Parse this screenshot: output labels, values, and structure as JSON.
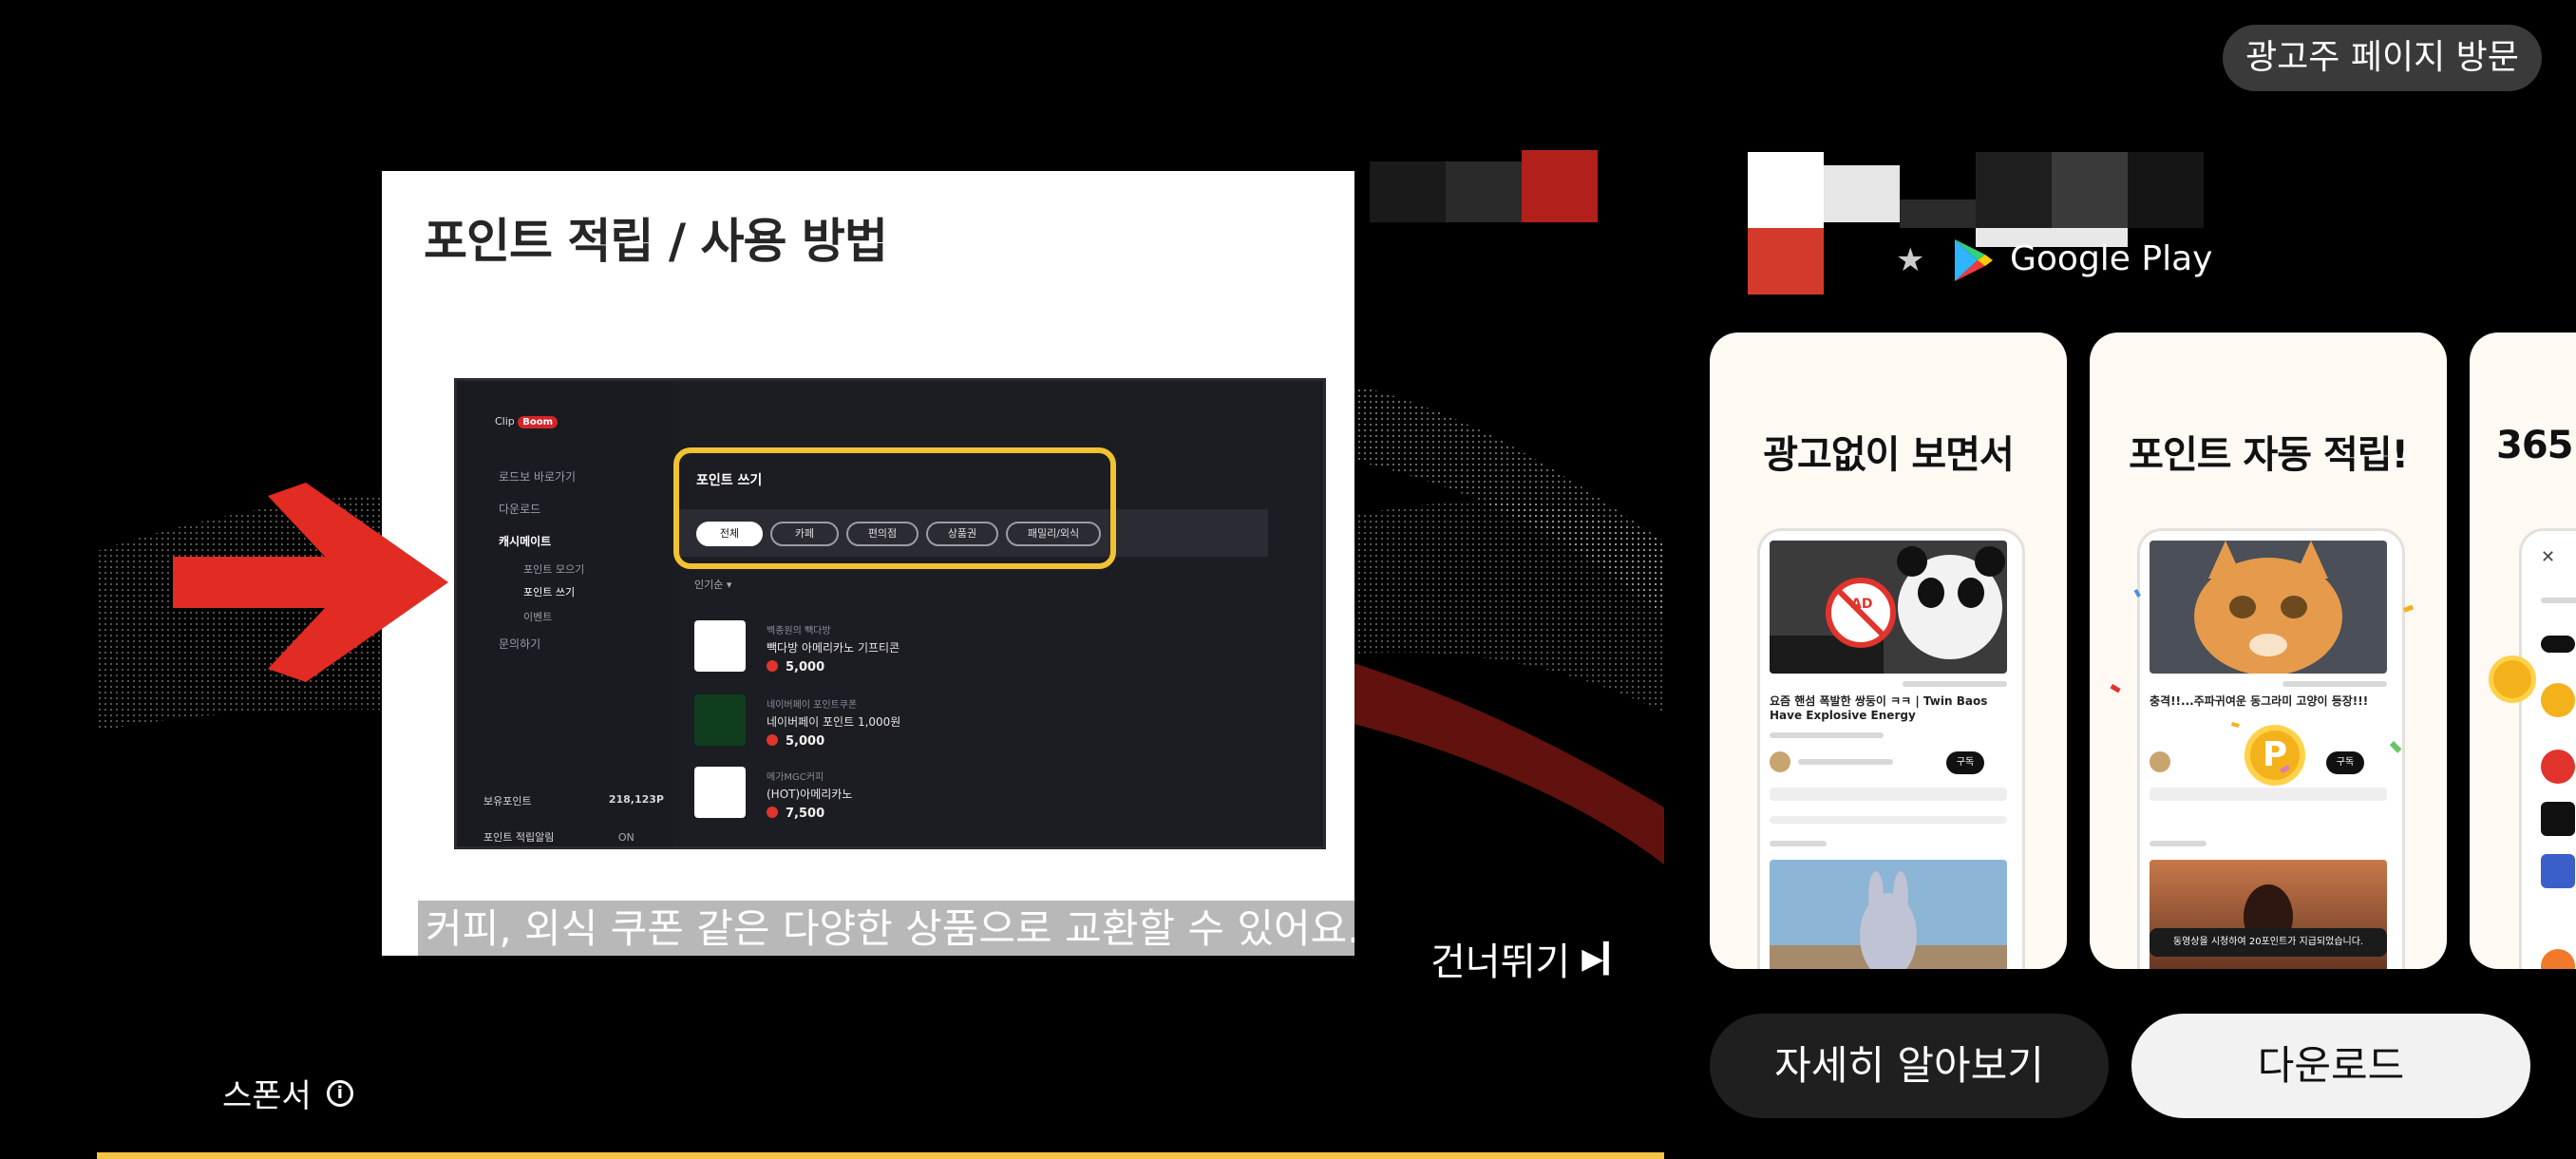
{
  "header": {
    "advertiser_page_label": "광고주 페이지 방문"
  },
  "video": {
    "slide_title": "포인트 적립 / 사용 방법",
    "caption": "커피, 외식 쿠폰 같은 다양한 상품으로 교환할 수 있어요.",
    "skip_label": "건너뛰기",
    "sponsor_label": "스폰서",
    "progress_fraction": 1.0,
    "mock_app": {
      "logo_text": "Clip",
      "logo_badge": "Boom",
      "menu_items": [
        "로드보 바로가기",
        "다운로드",
        "캐시메이트",
        "문의하기"
      ],
      "sub_items": [
        "포인트 모으기",
        "포인트 쓰기",
        "이벤트"
      ],
      "panel_title": "포인트 쓰기",
      "filter_chips": [
        "전체",
        "카페",
        "편의점",
        "상품권",
        "패밀리/외식"
      ],
      "sort_label": "인기순 ▾",
      "products": [
        {
          "brand": "백종원의 빽다방",
          "name": "빽다방 아메리카노 기프티콘",
          "price": "5,000"
        },
        {
          "brand": "네이버페이 포인트쿠폰",
          "name": "네이버페이 포인트 1,000원",
          "price": "5,000"
        },
        {
          "brand": "메가MGC커피",
          "name": "(HOT)아메리카노",
          "price": "7,500"
        }
      ],
      "balance_label": "보유포인트",
      "balance_value": "218,123P",
      "setting_label": "포인트 적립알림",
      "setting_value": "ON"
    }
  },
  "store": {
    "google_play_label": "Google Play"
  },
  "screenshots": [
    {
      "title": "광고없이 보면서",
      "phone_text": "요즘 핸섬 폭발한 쌍둥이 ㅋㅋ | Twin Baos Have Explosive Energy",
      "phone_badge": "AD",
      "subscribe_label": "구독"
    },
    {
      "title": "포인트 자동 적립!",
      "phone_text": "충격!!...주파귀여운 동그라미 고양이 등장!!!",
      "phone_badge": "P",
      "subscribe_label": "구독",
      "toast": "동영상을 시청하여 20포인트가 지급되었습니다."
    },
    {
      "title": "365"
    }
  ],
  "actions": {
    "learn_more_label": "자세히 알아보기",
    "download_label": "다운로드"
  },
  "colors": {
    "background": "#000000",
    "progress_bar": "#f4c542",
    "highlight_box": "#f1c232",
    "arrow_red": "#e22b22"
  }
}
